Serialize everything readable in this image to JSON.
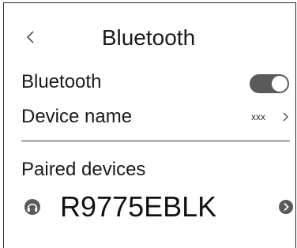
{
  "header": {
    "title": "Bluetooth",
    "back_icon": "chevron-left-icon"
  },
  "bluetooth_row": {
    "label": "Bluetooth",
    "toggle_on": true
  },
  "device_name_row": {
    "label": "Device name",
    "value": "xxx",
    "arrow_icon": "chevron-right-icon"
  },
  "paired": {
    "section_label": "Paired devices",
    "devices": [
      {
        "name": "R9775EBLK",
        "icon": "headphones-icon",
        "arrow_icon": "chevron-right-circle-icon"
      }
    ]
  },
  "colors": {
    "toggle_track": "#5a5a5a",
    "text": "#1a1a1a",
    "divider": "#3a3a3a"
  }
}
